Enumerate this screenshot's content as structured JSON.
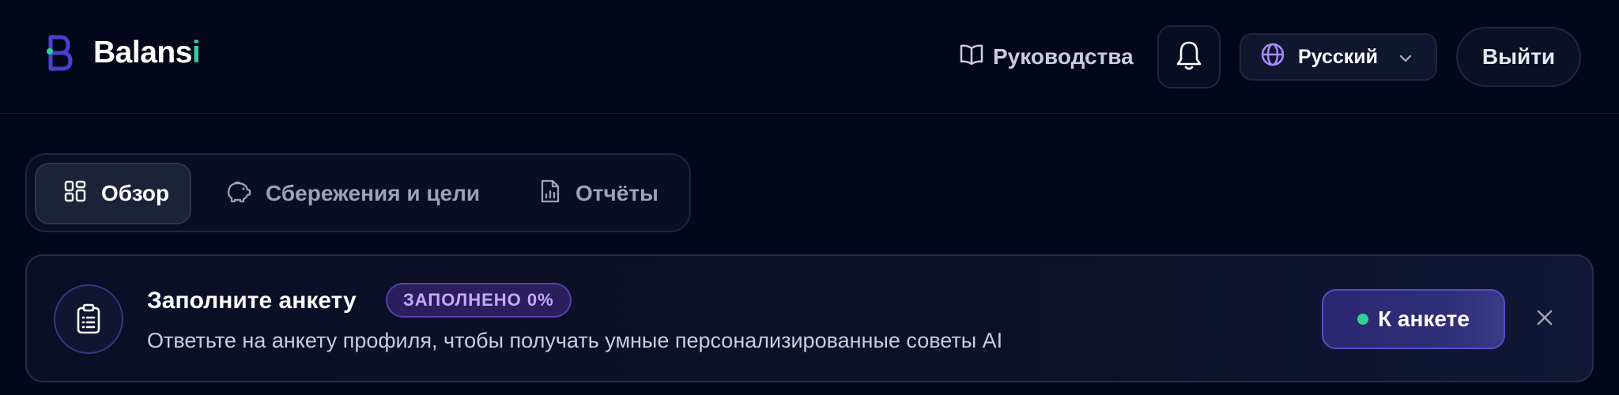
{
  "header": {
    "logo": {
      "text_main": "Balans",
      "text_accent": "i"
    },
    "guides_label": "Руководства",
    "language": {
      "selected": "Русский"
    },
    "logout_label": "Выйти"
  },
  "tabs": [
    {
      "label": "Обзор",
      "icon": "grid-icon",
      "active": true
    },
    {
      "label": "Сбережения и цели",
      "icon": "piggy-bank-icon",
      "active": false
    },
    {
      "label": "Отчёты",
      "icon": "report-icon",
      "active": false
    }
  ],
  "banner": {
    "title": "Заполните анкету",
    "badge": "ЗАПОЛНЕНО 0%",
    "description": "Ответьте на анкету профиля, чтобы получать умные персонализированные советы AI",
    "cta_label": "К анкете"
  },
  "colors": {
    "background": "#04071a",
    "accent_green": "#2fd39a",
    "accent_purple": "#8b6cf0"
  }
}
